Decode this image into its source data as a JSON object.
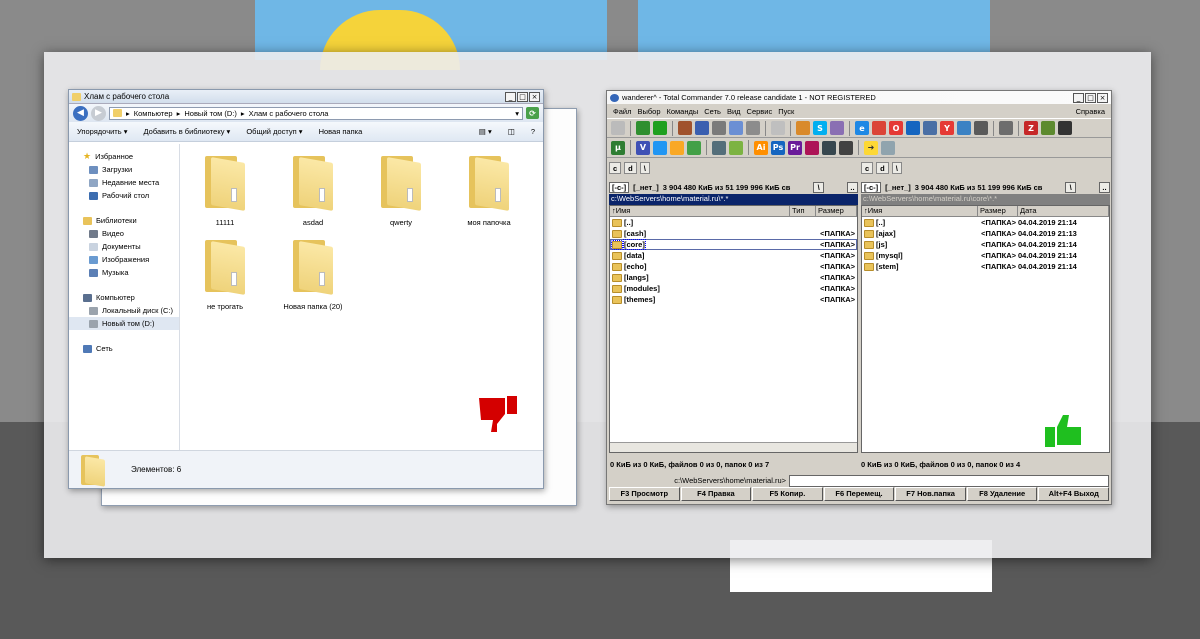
{
  "explorer": {
    "title": "Хлам с рабочего стола",
    "breadcrumb": [
      "Компьютер",
      "Новый том (D:)",
      "Хлам с рабочего стола"
    ],
    "commands": [
      "Упорядочить",
      "Добавить в библиотеку",
      "Общий доступ",
      "Новая папка"
    ],
    "nav": {
      "favorites": "Избранное",
      "favorites_items": [
        "Загрузки",
        "Недавние места",
        "Рабочий стол"
      ],
      "libraries": "Библиотеки",
      "libraries_items": [
        "Видео",
        "Документы",
        "Изображения",
        "Музыка"
      ],
      "computer": "Компьютер",
      "computer_items": [
        "Локальный диск (C:)",
        "Новый том (D:)"
      ],
      "network": "Сеть"
    },
    "folders": [
      "11111",
      "asdad",
      "qwerty",
      "моя папочка",
      "не трогать",
      "Новая папка (20)"
    ],
    "status": "Элементов: 6"
  },
  "tc": {
    "title": "wanderer^ - Total Commander 7.0 release candidate 1 - NOT REGISTERED",
    "menu": [
      "Файл",
      "Выбор",
      "Команды",
      "Сеть",
      "Вид",
      "Сервис",
      "Пуск"
    ],
    "help": "Справка",
    "drives": [
      "c",
      "d",
      "\\"
    ],
    "left": {
      "drive": "[-c-]",
      "label": "[_нет_]",
      "free": "3 904 480 КиБ из 51 199 996 КиБ св",
      "path": "c:\\WebServers\\home\\material.ru\\*.*",
      "cols": [
        "↑Имя",
        "Тип",
        "Размер"
      ],
      "rows": [
        {
          "name": "[..]",
          "size": ""
        },
        {
          "name": "[cash]",
          "size": "<ПАПКА>"
        },
        {
          "name": "[core]",
          "size": "<ПАПКА>"
        },
        {
          "name": "[data]",
          "size": "<ПАПКА>"
        },
        {
          "name": "[echo]",
          "size": "<ПАПКА>"
        },
        {
          "name": "[langs]",
          "size": "<ПАПКА>"
        },
        {
          "name": "[modules]",
          "size": "<ПАПКА>"
        },
        {
          "name": "[themes]",
          "size": "<ПАПКА>"
        }
      ],
      "status": "0 КиБ из 0 КиБ, файлов 0 из 0, папок 0 из 7"
    },
    "right": {
      "drive": "[-c-]",
      "label": "[_нет_]",
      "free": "3 904 480 КиБ из 51 199 996 КиБ св",
      "path": "c:\\WebServers\\home\\material.ru\\core\\*.*",
      "cols": [
        "↑Имя",
        "Размер",
        "Дата"
      ],
      "rows": [
        {
          "name": "[..]",
          "size": "<ПАПКА>",
          "date": "04.04.2019 21:14"
        },
        {
          "name": "[ajax]",
          "size": "<ПАПКА>",
          "date": "04.04.2019 21:13"
        },
        {
          "name": "[js]",
          "size": "<ПАПКА>",
          "date": "04.04.2019 21:14"
        },
        {
          "name": "[mysql]",
          "size": "<ПАПКА>",
          "date": "04.04.2019 21:14"
        },
        {
          "name": "[stem]",
          "size": "<ПАПКА>",
          "date": "04.04.2019 21:14"
        }
      ],
      "status": "0 КиБ из 0 КиБ, файлов 0 из 0, папок 0 из 4"
    },
    "cmdline": "c:\\WebServers\\home\\material.ru>",
    "fkeys": [
      "F3 Просмотр",
      "F4 Правка",
      "F5 Копир.",
      "F6 Перемещ.",
      "F7 Нов.папка",
      "F8 Удаление",
      "Alt+F4 Выход"
    ]
  },
  "colors": {
    "thumbs_down": "#d40000",
    "thumbs_up": "#1fbf1f",
    "accent": "#0a246a"
  }
}
